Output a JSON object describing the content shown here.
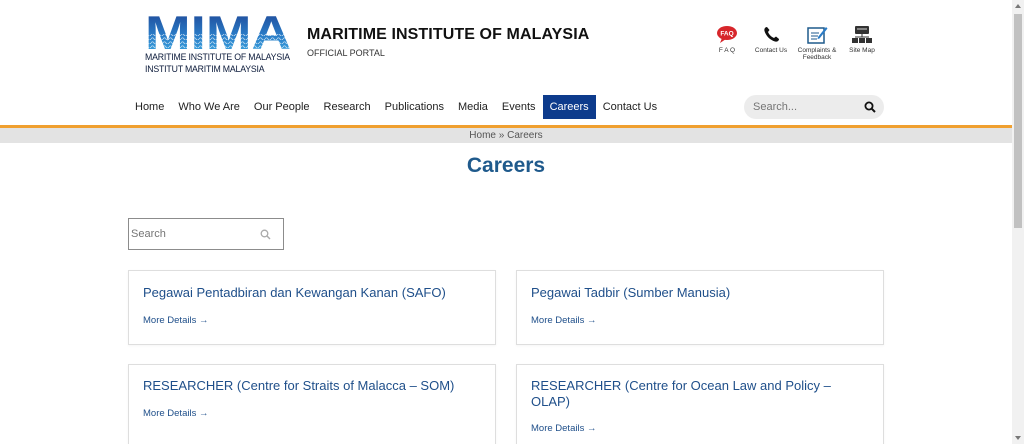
{
  "header": {
    "logo_text": "MIMA",
    "logo_line1": "MARITIME INSTITUTE OF MALAYSIA",
    "logo_line2": "INSTITUT MARITIM MALAYSIA",
    "title": "MARITIME INSTITUTE OF MALAYSIA",
    "subtitle": "OFFICIAL PORTAL",
    "utility": [
      {
        "label": "F A Q",
        "icon": "faq-icon"
      },
      {
        "label": "Contact Us",
        "icon": "phone-icon"
      },
      {
        "label": "Complaints &",
        "label2": "Feedback",
        "icon": "feedback-icon"
      },
      {
        "label": "Site Map",
        "icon": "sitemap-icon"
      }
    ]
  },
  "nav": {
    "items": [
      "Home",
      "Who We Are",
      "Our People",
      "Research",
      "Publications",
      "Media",
      "Events",
      "Careers",
      "Contact Us"
    ],
    "active": "Careers",
    "search_placeholder": "Search..."
  },
  "breadcrumb": {
    "home": "Home",
    "separator": " » ",
    "current": "Careers"
  },
  "page": {
    "title": "Careers",
    "search_placeholder": "Search"
  },
  "cards": [
    {
      "title": "Pegawai Pentadbiran dan Kewangan Kanan (SAFO)",
      "link": "More Details →"
    },
    {
      "title": "Pegawai Tadbir (Sumber Manusia)",
      "link": "More Details →"
    },
    {
      "title": "RESEARCHER (Centre for Straits of Malacca – SOM)",
      "link": "More Details →"
    },
    {
      "title": "RESEARCHER (Centre for Ocean Law and Policy – OLAP)",
      "link": "More Details →"
    }
  ],
  "colors": {
    "brand_blue": "#0d3b8c",
    "link_blue": "#1f4f8a",
    "title_blue": "#1f5a8c",
    "accent_orange": "#f0a030",
    "breadcrumb_bg": "#e3e3e3"
  }
}
